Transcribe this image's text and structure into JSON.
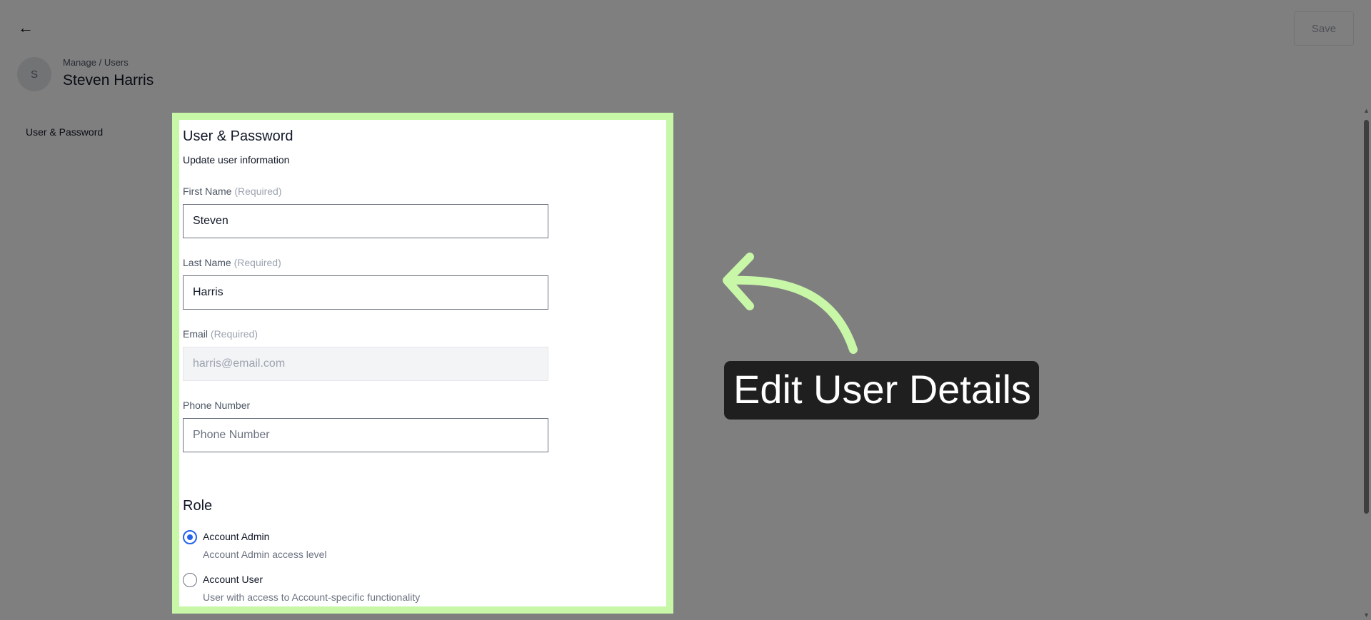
{
  "header": {
    "back_icon": "arrow-left-icon",
    "save_label": "Save",
    "avatar_initial": "S",
    "breadcrumb": "Manage / Users",
    "title": "Steven Harris"
  },
  "sidebar": {
    "items": [
      {
        "label": "User & Password"
      }
    ]
  },
  "form": {
    "title": "User & Password",
    "subtitle": "Update user information",
    "first_name": {
      "label": "First Name",
      "required": "(Required)",
      "value": "Steven"
    },
    "last_name": {
      "label": "Last Name",
      "required": "(Required)",
      "value": "Harris"
    },
    "email": {
      "label": "Email",
      "required": "(Required)",
      "value": "harris@email.com"
    },
    "phone": {
      "label": "Phone Number",
      "placeholder": "Phone Number",
      "value": ""
    }
  },
  "role": {
    "title": "Role",
    "options": [
      {
        "label": "Account Admin",
        "description": "Account Admin access level",
        "selected": true
      },
      {
        "label": "Account User",
        "description": "User with access to Account-specific functionality",
        "selected": false
      }
    ]
  },
  "callout": {
    "text": "Edit User Details",
    "arrow_color": "#c8f7a8",
    "highlight_color": "#c8f7a8"
  }
}
